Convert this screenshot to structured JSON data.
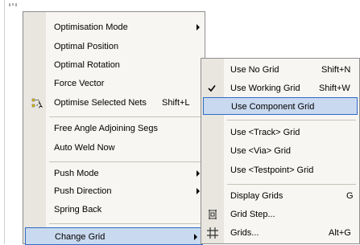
{
  "main_menu": {
    "items": [
      {
        "label": "Optimisation Mode",
        "submenu": true
      },
      {
        "label": "Optimal Position"
      },
      {
        "label": "Optimal Rotation"
      },
      {
        "label": "Force Vector"
      },
      {
        "label": "Optimise Selected Nets",
        "shortcut": "Shift+L",
        "icon": "optimise-nets-icon"
      },
      {
        "label": "Free Angle Adjoining Segs"
      },
      {
        "label": "Auto Weld Now"
      },
      {
        "label": "Push Mode",
        "submenu": true
      },
      {
        "label": "Push Direction",
        "submenu": true
      },
      {
        "label": "Spring Back"
      },
      {
        "label": "Change Grid",
        "submenu": true,
        "highlighted": true
      }
    ]
  },
  "grid_submenu": {
    "items": [
      {
        "label": "Use No Grid",
        "shortcut": "Shift+N"
      },
      {
        "label": "Use Working Grid",
        "shortcut": "Shift+W",
        "checked": true
      },
      {
        "label": "Use Component Grid",
        "highlighted": true
      },
      {
        "label": "Use <Track> Grid"
      },
      {
        "label": "Use <Via> Grid"
      },
      {
        "label": "Use <Testpoint> Grid"
      },
      {
        "label": "Display Grids",
        "shortcut": "G"
      },
      {
        "label": "Grid Step...",
        "icon": "grid-step-icon"
      },
      {
        "label": "Grids...",
        "shortcut": "Alt+G",
        "icon": "grids-icon"
      }
    ]
  },
  "colors": {
    "menu_bg": "#f7f6f2",
    "gutter_bg": "#e8e6de",
    "highlight_bg": "#c9d9ef",
    "highlight_border": "#316ac5"
  }
}
